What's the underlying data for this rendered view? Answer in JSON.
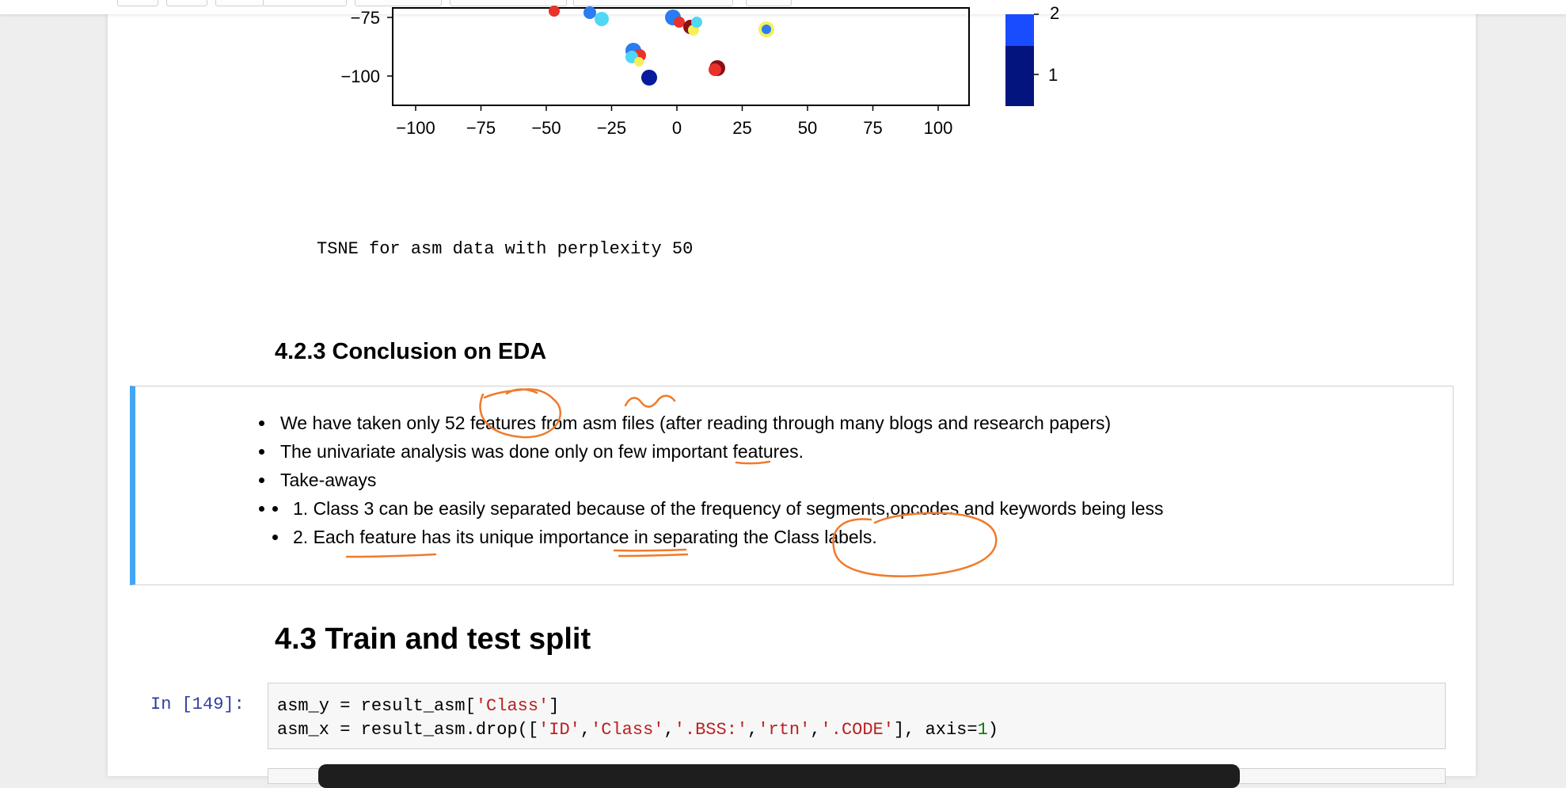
{
  "plot": {
    "x_ticks": [
      "−100",
      "−75",
      "−50",
      "−25",
      "0",
      "25",
      "50",
      "75",
      "100"
    ],
    "y_ticks": [
      "−75",
      "−100"
    ],
    "colorbar_ticks": [
      "2",
      "1"
    ],
    "colors": {
      "dark_red": "#8b0f14",
      "red": "#e8322a",
      "cyan": "#4fd7f5",
      "blue": "#2a7cf2",
      "navy": "#061a9e",
      "yellow": "#f4f05a",
      "colorbar_top": "#1a4cff",
      "colorbar_bottom": "#04147f"
    }
  },
  "output": {
    "text": "TSNE for asm data with perplexity 50"
  },
  "section_eda": {
    "title": "4.2.3 Conclusion on EDA"
  },
  "conclusion": {
    "bullets": [
      "We have taken only 52 features from asm files (after reading through many blogs and research papers)",
      "The univariate analysis was done only on few important features.",
      "Take-aways"
    ],
    "sub_bullets": [
      "1. Class 3 can be easily separated because of the frequency of segments,opcodes and keywords being less",
      "2. Each feature has its unique importance in separating the Class labels."
    ],
    "accent_color": "#42a5f5",
    "annotation_color": "#f07a2b"
  },
  "section_split": {
    "title": "4.3 Train and test split"
  },
  "code_cell": {
    "prompt": "In [149]:",
    "line1": {
      "pre": "asm_y = result_asm[",
      "str": "'Class'",
      "post": "]"
    },
    "line2": {
      "pre": "asm_x = result_asm.drop([",
      "s1": "'ID'",
      "c1": ",",
      "s2": "'Class'",
      "c2": ",",
      "s3": "'.BSS:'",
      "c3": ",",
      "s4": "'rtn'",
      "c4": ",",
      "s5": "'.CODE'",
      "mid": "], axis=",
      "num": "1",
      "post": ")"
    }
  }
}
